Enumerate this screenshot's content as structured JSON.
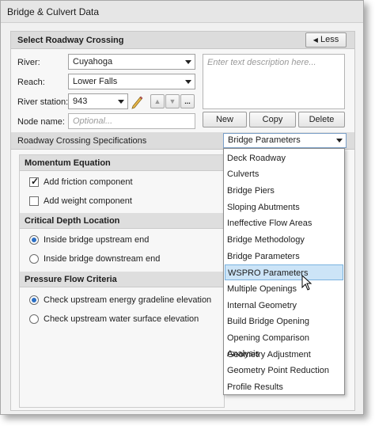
{
  "window": {
    "title": "Bridge & Culvert Data"
  },
  "select_section": {
    "header": "Select Roadway Crossing",
    "less_button": "Less",
    "river_label": "River:",
    "river_value": "Cuyahoga",
    "reach_label": "Reach:",
    "reach_value": "Lower Falls",
    "station_label": "River station:",
    "station_value": "943",
    "node_label": "Node name:",
    "node_placeholder": "Optional...",
    "description_placeholder": "Enter text description here...",
    "ellipsis_label": "...",
    "new_button": "New",
    "copy_button": "Copy",
    "delete_button": "Delete"
  },
  "specs": {
    "label": "Roadway Crossing Specifications",
    "selected": "Bridge Parameters",
    "options": [
      "Deck Roadway",
      "Culverts",
      "Bridge Piers",
      "Sloping Abutments",
      "Ineffective Flow Areas",
      "Bridge Methodology",
      "Bridge Parameters",
      "WSPRO Parameters",
      "Multiple Openings",
      "Internal Geometry",
      "Build Bridge Opening",
      "Opening Comparison Analysis",
      "Geometry Adjustment",
      "Geometry Point Reduction",
      "Profile Results"
    ],
    "highlighted_index": 7
  },
  "momentum": {
    "header": "Momentum Equation",
    "friction_label": "Add friction component",
    "friction_checked": true,
    "weight_label": "Add weight component",
    "weight_checked": false
  },
  "critical_depth": {
    "header": "Critical Depth Location",
    "upstream_label": "Inside bridge upstream end",
    "downstream_label": "Inside bridge downstream end",
    "selected": "upstream"
  },
  "pressure_flow": {
    "header": "Pressure Flow Criteria",
    "energy_label": "Check upstream energy gradeline elevation",
    "wse_label": "Check upstream water surface elevation",
    "selected": "energy"
  },
  "colors": {
    "highlight": "#cce4f7",
    "highlight_border": "#7ab3e0",
    "radio_dot": "#2c6fc4"
  }
}
